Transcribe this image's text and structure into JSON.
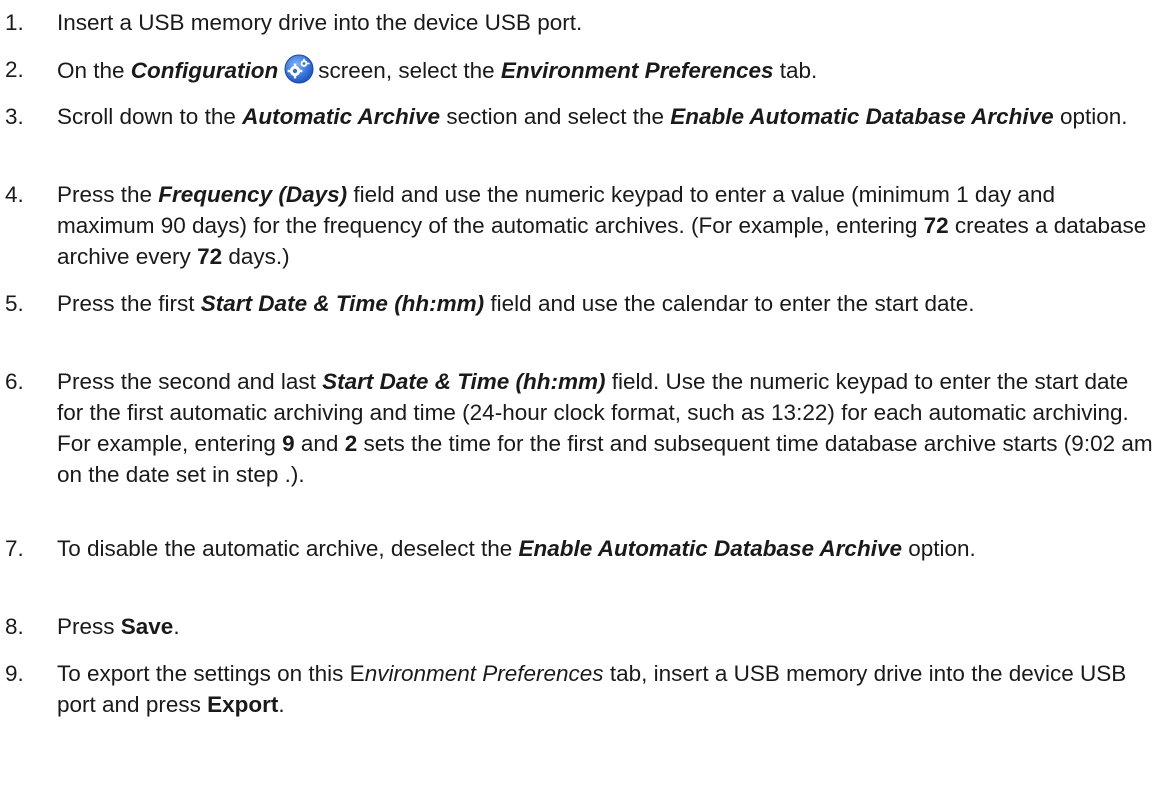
{
  "steps": [
    {
      "num": "1.",
      "parts": [
        {
          "t": "Insert a USB memory drive into the device USB port."
        }
      ]
    },
    {
      "num": "2.",
      "parts": [
        {
          "t": "On the "
        },
        {
          "t": "Configuration",
          "s": "bi"
        },
        {
          "icon": "gear-icon"
        },
        {
          "t": "screen, select the "
        },
        {
          "t": "Environment Preferences",
          "s": "bi"
        },
        {
          "t": " tab."
        }
      ]
    },
    {
      "num": "3.",
      "parts": [
        {
          "t": "Scroll down to the "
        },
        {
          "t": "Automatic Archive",
          "s": "bi"
        },
        {
          "t": " section and select the "
        },
        {
          "t": "Enable Automatic Database Archive",
          "s": "bi"
        },
        {
          "t": " option."
        }
      ]
    },
    {
      "num": "4.",
      "parts": [
        {
          "t": "Press the "
        },
        {
          "t": "Frequency (Days)",
          "s": "bi"
        },
        {
          "t": " field and use the numeric keypad to enter a value (minimum 1 day and maximum 90 days) for the frequency of the automatic archives. (For example, entering "
        },
        {
          "t": "72",
          "s": "b"
        },
        {
          "t": " creates a database archive every "
        },
        {
          "t": "72",
          "s": "b"
        },
        {
          "t": " days.)"
        }
      ]
    },
    {
      "num": "5.",
      "parts": [
        {
          "t": "Press the first "
        },
        {
          "t": "Start Date & Time (hh:mm)",
          "s": "bi"
        },
        {
          "t": " field and use the calendar to enter the start date."
        }
      ]
    },
    {
      "num": "6.",
      "parts": [
        {
          "t": "Press the second and last "
        },
        {
          "t": "Start Date & Time (hh:mm)",
          "s": "bi"
        },
        {
          "t": " field. Use the numeric keypad to enter the start date for the first automatic archiving and time (24-hour clock format, such as 13:22) for each automatic archiving. For example, entering "
        },
        {
          "t": "9",
          "s": "b"
        },
        {
          "t": " and "
        },
        {
          "t": "2",
          "s": "b"
        },
        {
          "t": " sets the time for the first and subsequent time database archive starts (9:02 am on the date set in step .)."
        }
      ]
    },
    {
      "num": "7.",
      "parts": [
        {
          "t": "To disable the automatic archive, deselect the "
        },
        {
          "t": "Enable Automatic Database Archive",
          "s": "bi"
        },
        {
          "t": " option."
        }
      ]
    },
    {
      "num": "8.",
      "parts": [
        {
          "t": "Press "
        },
        {
          "t": "Save",
          "s": "b"
        },
        {
          "t": "."
        }
      ]
    },
    {
      "num": "9.",
      "parts": [
        {
          "t": "To export the settings on this E"
        },
        {
          "t": "nvironment Preferences",
          "s": "i"
        },
        {
          "t": " tab, insert a USB memory drive into the device USB port and press "
        },
        {
          "t": "Export",
          "s": "b"
        },
        {
          "t": "."
        }
      ]
    }
  ]
}
